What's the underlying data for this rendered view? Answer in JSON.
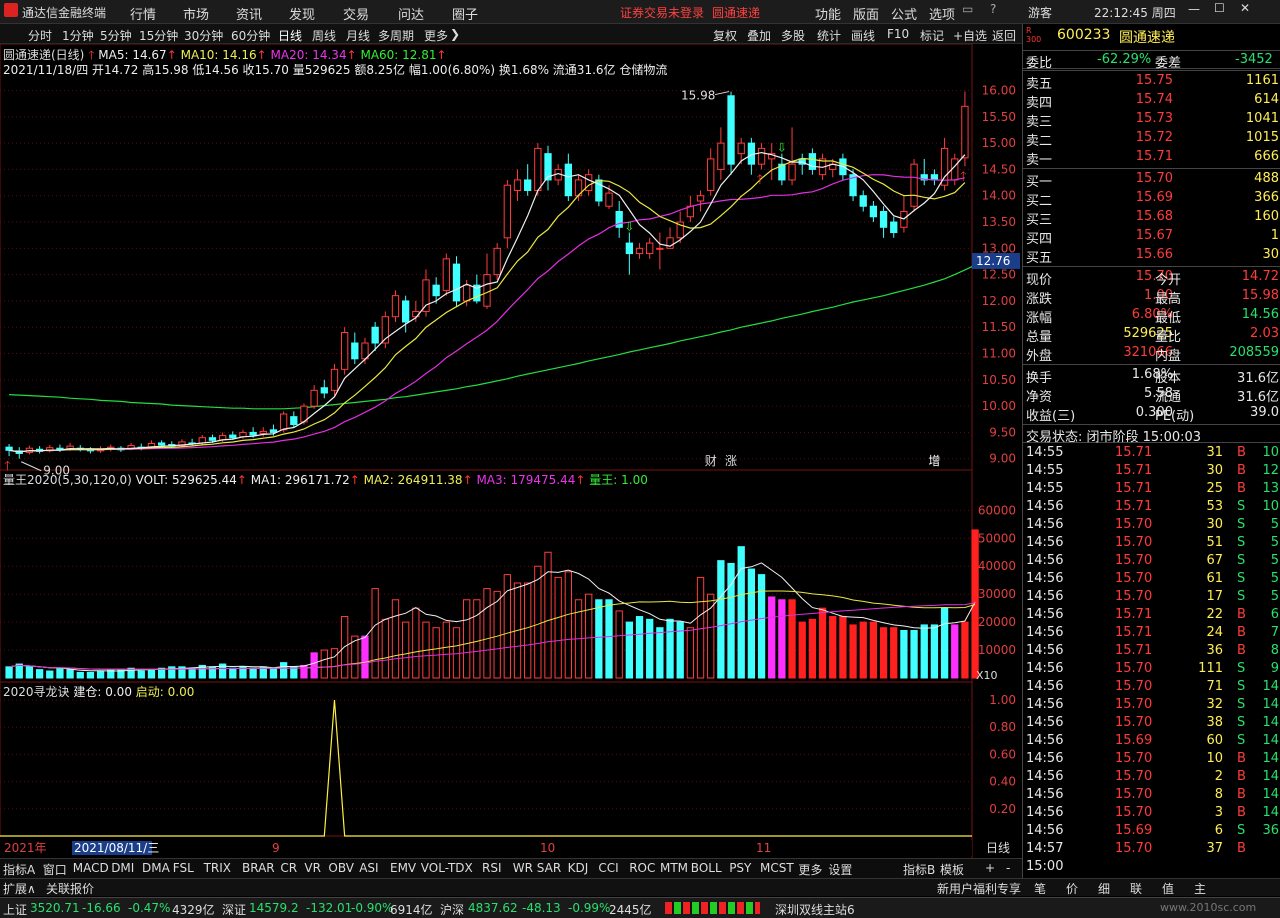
{
  "menu": {
    "app_title": "通达信金融终端",
    "items": [
      "行情",
      "市场",
      "资讯",
      "发现",
      "交易",
      "问达",
      "圈子"
    ],
    "notice": "证券交易未登录",
    "stock_link": "圆通速递",
    "right_items": [
      "功能",
      "版面",
      "公式",
      "选项"
    ],
    "user": "游客",
    "clock": "22:12:45 周四"
  },
  "periods": [
    "分时",
    "1分钟",
    "5分钟",
    "15分钟",
    "30分钟",
    "60分钟",
    "日线",
    "周线",
    "月线",
    "多周期",
    "更多"
  ],
  "toolbar": [
    "复权",
    "叠加",
    "多股",
    "统计",
    "画线",
    "F10",
    "标记",
    "+自选",
    "返回"
  ],
  "chart_data": {
    "type": "candlestick",
    "title": "圆通速递(日线)",
    "ma_labels": [
      "MA5: 14.67",
      "MA10: 14.16",
      "MA20: 14.34",
      "MA60: 12.81"
    ],
    "info_line": "2021/11/18/四 开14.72 高15.98 低14.56 收15.70 量529625 额8.25亿 幅1.00(6.80%) 换1.68% 流通31.6亿 仓储物流",
    "y_ticks": [
      "16.00",
      "15.50",
      "15.00",
      "14.50",
      "14.00",
      "13.50",
      "13.00",
      "12.50",
      "12.00",
      "11.50",
      "11.00",
      "10.50",
      "10.00",
      "9.50",
      "9.00"
    ],
    "ylim": [
      8.9,
      16.2
    ],
    "current_price_tag": "12.76",
    "high_label": "15.98",
    "low_label": "9.00",
    "event_labels": [
      "财",
      "涨",
      "增"
    ],
    "candles": [
      [
        9.22,
        9.16,
        9.28,
        9.05
      ],
      [
        9.15,
        9.1,
        9.22,
        9.0
      ],
      [
        9.12,
        9.2,
        9.25,
        9.08
      ],
      [
        9.18,
        9.14,
        9.24,
        9.1
      ],
      [
        9.15,
        9.21,
        9.26,
        9.12
      ],
      [
        9.2,
        9.17,
        9.27,
        9.13
      ],
      [
        9.18,
        9.24,
        9.3,
        9.15
      ],
      [
        9.2,
        9.18,
        9.26,
        9.14
      ],
      [
        9.18,
        9.15,
        9.22,
        9.1
      ],
      [
        9.15,
        9.19,
        9.24,
        9.11
      ],
      [
        9.18,
        9.22,
        9.27,
        9.14
      ],
      [
        9.2,
        9.17,
        9.24,
        9.13
      ],
      [
        9.18,
        9.25,
        9.3,
        9.16
      ],
      [
        9.22,
        9.2,
        9.29,
        9.16
      ],
      [
        9.22,
        9.29,
        9.35,
        9.19
      ],
      [
        9.3,
        9.26,
        9.35,
        9.22
      ],
      [
        9.27,
        9.24,
        9.33,
        9.2
      ],
      [
        9.25,
        9.32,
        9.37,
        9.22
      ],
      [
        9.3,
        9.28,
        9.38,
        9.24
      ],
      [
        9.3,
        9.4,
        9.45,
        9.27
      ],
      [
        9.4,
        9.35,
        9.46,
        9.3
      ],
      [
        9.36,
        9.44,
        9.5,
        9.32
      ],
      [
        9.45,
        9.4,
        9.52,
        9.36
      ],
      [
        9.42,
        9.5,
        9.55,
        9.38
      ],
      [
        9.5,
        9.45,
        9.6,
        9.4
      ],
      [
        9.48,
        9.52,
        9.6,
        9.42
      ],
      [
        9.55,
        9.5,
        9.65,
        9.44
      ],
      [
        9.55,
        9.85,
        9.9,
        9.5
      ],
      [
        9.8,
        9.65,
        9.9,
        9.6
      ],
      [
        9.7,
        10.0,
        10.05,
        9.65
      ],
      [
        10.0,
        10.3,
        10.4,
        9.95
      ],
      [
        10.35,
        10.25,
        10.5,
        10.15
      ],
      [
        10.3,
        10.7,
        10.8,
        10.2
      ],
      [
        10.7,
        11.4,
        11.5,
        10.6
      ],
      [
        11.2,
        10.9,
        11.4,
        10.8
      ],
      [
        10.9,
        11.2,
        11.3,
        10.8
      ],
      [
        11.5,
        11.2,
        11.6,
        11.05
      ],
      [
        11.2,
        11.7,
        11.8,
        11.1
      ],
      [
        11.7,
        12.1,
        12.2,
        11.6
      ],
      [
        12.0,
        11.6,
        12.1,
        11.4
      ],
      [
        11.7,
        11.8,
        12.0,
        11.6
      ],
      [
        11.8,
        12.4,
        12.6,
        11.7
      ],
      [
        12.3,
        12.1,
        12.45,
        11.95
      ],
      [
        12.2,
        12.8,
        12.9,
        12.1
      ],
      [
        12.7,
        12.0,
        12.85,
        11.9
      ],
      [
        12.0,
        12.3,
        12.4,
        11.9
      ],
      [
        12.3,
        12.0,
        12.5,
        11.95
      ],
      [
        11.9,
        12.5,
        12.9,
        11.85
      ],
      [
        12.5,
        13.0,
        13.1,
        12.4
      ],
      [
        13.2,
        14.2,
        14.3,
        13.0
      ],
      [
        14.1,
        14.3,
        14.5,
        13.9
      ],
      [
        14.3,
        14.1,
        14.6,
        14.0
      ],
      [
        14.1,
        14.9,
        15.0,
        14.0
      ],
      [
        14.8,
        14.3,
        14.95,
        14.1
      ],
      [
        14.3,
        14.5,
        14.6,
        14.2
      ],
      [
        14.6,
        14.0,
        14.8,
        13.9
      ],
      [
        14.0,
        14.3,
        14.4,
        13.9
      ],
      [
        14.1,
        14.4,
        14.5,
        14.0
      ],
      [
        14.3,
        13.9,
        14.4,
        13.8
      ],
      [
        13.8,
        14.05,
        14.2,
        13.75
      ],
      [
        13.7,
        13.4,
        13.9,
        13.2
      ],
      [
        13.1,
        12.9,
        13.3,
        12.5
      ],
      [
        12.9,
        13.0,
        13.1,
        12.8
      ],
      [
        12.9,
        13.1,
        13.2,
        12.8
      ],
      [
        13.0,
        13.0,
        13.3,
        12.6
      ],
      [
        13.0,
        13.2,
        13.4,
        13.0
      ],
      [
        13.2,
        13.5,
        13.7,
        13.1
      ],
      [
        13.6,
        13.8,
        14.0,
        13.5
      ],
      [
        13.9,
        14.0,
        14.1,
        13.7
      ],
      [
        14.1,
        14.7,
        14.9,
        14.0
      ],
      [
        14.5,
        15.0,
        15.3,
        14.3
      ],
      [
        15.9,
        14.6,
        15.98,
        14.4
      ],
      [
        14.8,
        15.0,
        15.1,
        14.6
      ],
      [
        15.0,
        14.6,
        15.1,
        14.4
      ],
      [
        14.6,
        14.9,
        15.0,
        14.5
      ],
      [
        14.7,
        14.8,
        15.0,
        14.3
      ],
      [
        14.6,
        14.3,
        14.8,
        14.2
      ],
      [
        14.3,
        14.6,
        15.3,
        14.2
      ],
      [
        14.7,
        14.6,
        14.8,
        14.4
      ],
      [
        14.8,
        14.5,
        14.9,
        14.4
      ],
      [
        14.4,
        14.7,
        14.8,
        14.3
      ],
      [
        14.5,
        14.6,
        14.7,
        14.35
      ],
      [
        14.7,
        14.4,
        14.8,
        14.3
      ],
      [
        14.4,
        14.0,
        14.5,
        13.9
      ],
      [
        14.0,
        13.8,
        14.1,
        13.7
      ],
      [
        13.8,
        13.6,
        13.9,
        13.5
      ],
      [
        13.7,
        13.4,
        13.8,
        13.2
      ],
      [
        13.5,
        13.3,
        13.6,
        13.2
      ],
      [
        13.4,
        13.7,
        14.0,
        13.3
      ],
      [
        13.8,
        14.6,
        14.7,
        13.7
      ],
      [
        14.4,
        14.3,
        14.7,
        14.2
      ],
      [
        14.4,
        14.3,
        14.5,
        14.2
      ],
      [
        14.2,
        14.9,
        15.1,
        14.1
      ],
      [
        14.3,
        14.7,
        14.8,
        14.2
      ],
      [
        14.72,
        15.7,
        15.98,
        14.56
      ]
    ],
    "ma60": [
      10.22,
      10.21,
      10.2,
      10.19,
      10.18,
      10.17,
      10.15,
      10.14,
      10.13,
      10.11,
      10.1,
      10.09,
      10.07,
      10.06,
      10.05,
      10.04,
      10.02,
      10.01,
      10.0,
      9.99,
      9.98,
      9.97,
      9.96,
      9.96,
      9.95,
      9.95,
      9.95,
      9.95,
      9.96,
      9.97,
      9.99,
      10.01,
      10.03,
      10.05,
      10.07,
      10.09,
      10.11,
      10.13,
      10.16,
      10.18,
      10.21,
      10.24,
      10.27,
      10.3,
      10.33,
      10.37,
      10.4,
      10.44,
      10.48,
      10.52,
      10.57,
      10.61,
      10.65,
      10.69,
      10.73,
      10.77,
      10.81,
      10.86,
      10.9,
      10.94,
      10.98,
      11.03,
      11.07,
      11.11,
      11.15,
      11.19,
      11.24,
      11.28,
      11.32,
      11.36,
      11.41,
      11.45,
      11.5,
      11.54,
      11.58,
      11.62,
      11.67,
      11.71,
      11.75,
      11.8,
      11.84,
      11.88,
      11.93,
      11.98,
      12.02,
      12.06,
      12.1,
      12.15,
      12.2,
      12.25,
      12.3,
      12.36,
      12.42,
      12.5,
      12.59,
      12.68
    ],
    "volume_panel": {
      "title": "量王2020(5,30,120,0)",
      "labels": [
        "VOLT: 529625.44",
        "MA1: 296171.72",
        "MA2: 264911.38",
        "MA3: 179475.44",
        "量王: 1.00"
      ],
      "y_ticks": [
        "60000",
        "50000",
        "40000",
        "30000",
        "20000",
        "10000"
      ],
      "unit": "X10"
    },
    "volumes": [
      4000,
      5000,
      4000,
      3000,
      2500,
      3500,
      3000,
      2000,
      2000,
      2500,
      3000,
      3000,
      3500,
      2500,
      3000,
      3500,
      4000,
      4000,
      3500,
      4500,
      4000,
      5000,
      3500,
      4000,
      3500,
      4000,
      3500,
      5500,
      4000,
      4500,
      9000,
      10000,
      10500,
      22000,
      15000,
      15000,
      32000,
      21000,
      28000,
      20000,
      25000,
      20000,
      18000,
      20000,
      18000,
      28000,
      28000,
      32000,
      31000,
      37000,
      34000,
      34000,
      40000,
      45000,
      36000,
      38000,
      28000,
      30000,
      28000,
      28000,
      24000,
      20000,
      22000,
      21000,
      18000,
      21000,
      20000,
      18000,
      36000,
      30000,
      42000,
      41000,
      47000,
      39000,
      37000,
      29000,
      28000,
      28000,
      20000,
      21000,
      25000,
      22000,
      22000,
      19000,
      20000,
      20000,
      18000,
      18000,
      17000,
      17000,
      19000,
      19000,
      25000,
      19000,
      20000,
      53000
    ],
    "vol_colors": "cccccccccccccccccccccccccccccmmhhhhmhhhhhhhhhhhhhhhhhhhhhhcchcccccchhhcccccmmrrrrrrrrrrrcccccmrrrr",
    "signal_panel": {
      "title": "2020寻龙诀",
      "labels": [
        "建仓: 0.00",
        "启动: 0.00"
      ],
      "y_ticks": [
        "1.00",
        "0.80",
        "0.60",
        "0.40",
        "0.20"
      ],
      "spike_index": 32
    },
    "x_labels": [
      "2021年",
      "2021/08/11/三",
      "9",
      "10",
      "11"
    ],
    "period_label": "日线"
  },
  "quote": {
    "code": "600233",
    "name": "圆通速递",
    "tag": "R 300",
    "webi": "-62.29%",
    "wecha": "-3452",
    "asks": [
      [
        "卖五",
        "15.75",
        "1161"
      ],
      [
        "卖四",
        "15.74",
        "614"
      ],
      [
        "卖三",
        "15.73",
        "1041"
      ],
      [
        "卖二",
        "15.72",
        "1015"
      ],
      [
        "卖一",
        "15.71",
        "666"
      ]
    ],
    "bids": [
      [
        "买一",
        "15.70",
        "488"
      ],
      [
        "买二",
        "15.69",
        "366"
      ],
      [
        "买三",
        "15.68",
        "160"
      ],
      [
        "买四",
        "15.67",
        "1"
      ],
      [
        "买五",
        "15.66",
        "30"
      ]
    ],
    "stats": [
      [
        "现价",
        "15.70",
        "今开",
        "14.72"
      ],
      [
        "涨跌",
        "1.00",
        "最高",
        "15.98"
      ],
      [
        "涨幅",
        "6.80%",
        "最低",
        "14.56"
      ],
      [
        "总量",
        "529625",
        "量比",
        "2.03"
      ],
      [
        "外盘",
        "321066",
        "内盘",
        "208559"
      ]
    ],
    "stats2": [
      [
        "换手",
        "1.68%",
        "股本",
        "31.6亿"
      ],
      [
        "净资",
        "5.58",
        "流通",
        "31.6亿"
      ],
      [
        "收益(三)",
        "0.300",
        "PE(动)",
        "39.0"
      ]
    ],
    "trade_state": "交易状态: 闭市阶段 15:00:03",
    "ticks": [
      [
        "14:55",
        "15.71",
        "31",
        "B"
      ],
      [
        "14:55",
        "15.71",
        "30",
        "B"
      ],
      [
        "14:55",
        "15.71",
        "25",
        "B"
      ],
      [
        "14:56",
        "15.71",
        "53",
        "S"
      ],
      [
        "14:56",
        "15.70",
        "30",
        "S"
      ],
      [
        "14:56",
        "15.70",
        "51",
        "S"
      ],
      [
        "14:56",
        "15.70",
        "67",
        "S"
      ],
      [
        "14:56",
        "15.70",
        "61",
        "S"
      ],
      [
        "14:56",
        "15.70",
        "17",
        "S"
      ],
      [
        "14:56",
        "15.71",
        "22",
        "B"
      ],
      [
        "14:56",
        "15.71",
        "24",
        "B"
      ],
      [
        "14:56",
        "15.71",
        "36",
        "B"
      ],
      [
        "14:56",
        "15.70",
        "111",
        "S"
      ],
      [
        "14:56",
        "15.70",
        "71",
        "S"
      ],
      [
        "14:56",
        "15.70",
        "32",
        "S"
      ],
      [
        "14:56",
        "15.70",
        "38",
        "S"
      ],
      [
        "14:56",
        "15.69",
        "60",
        "S"
      ],
      [
        "14:56",
        "15.70",
        "10",
        "B"
      ],
      [
        "14:56",
        "15.70",
        "2",
        "B"
      ],
      [
        "14:56",
        "15.70",
        "8",
        "B"
      ],
      [
        "14:56",
        "15.70",
        "3",
        "B"
      ],
      [
        "14:56",
        "15.69",
        "6",
        "S"
      ],
      [
        "14:57",
        "15.70",
        "37",
        "B"
      ],
      [
        "15:00",
        "",
        "",
        ""
      ]
    ],
    "tick_extras": [
      "10",
      "12",
      "13",
      "10",
      "5",
      "5",
      "5",
      "5",
      "5",
      "6",
      "7",
      "8",
      "9",
      "14",
      "14",
      "14",
      "14",
      "14",
      "14",
      "14",
      "14",
      "36"
    ]
  },
  "indicator_tabs": [
    "指标A",
    "窗口",
    "MACD",
    "DMI",
    "DMA",
    "FSL",
    "TRIX",
    "BRAR",
    "CR",
    "VR",
    "OBV",
    "ASI",
    "EMV",
    "VOL-TDX",
    "RSI",
    "WR",
    "SAR",
    "KDJ",
    "CCI",
    "ROC",
    "MTM",
    "BOLL",
    "PSY",
    "MCST",
    "更多",
    "设置"
  ],
  "indicator_right": [
    "指标B",
    "模板",
    "+",
    "-"
  ],
  "bottom2": {
    "left": [
      "扩展∧",
      "关联报价"
    ],
    "right": [
      "新用户福利专享",
      "笔",
      "价",
      "细",
      "联",
      "值",
      "主"
    ]
  },
  "status": {
    "sh_label": "上证",
    "sh_val": "3520.71",
    "sh_chg": "-16.66",
    "sh_pct": "-0.47%",
    "sh_amt": "4329亿",
    "sz_label": "深证",
    "sz_val": "14579.2",
    "sz_chg": "-132.01",
    "sz_pct": "-0.90%",
    "sz_amt": "6914亿",
    "hs_label": "沪深",
    "hs_val": "4837.62",
    "hs_chg": "-48.13",
    "hs_pct": "-0.99%",
    "hs_amt": "2445亿",
    "station": "深圳双线主站6",
    "watermark": "www.2010sc.com"
  }
}
